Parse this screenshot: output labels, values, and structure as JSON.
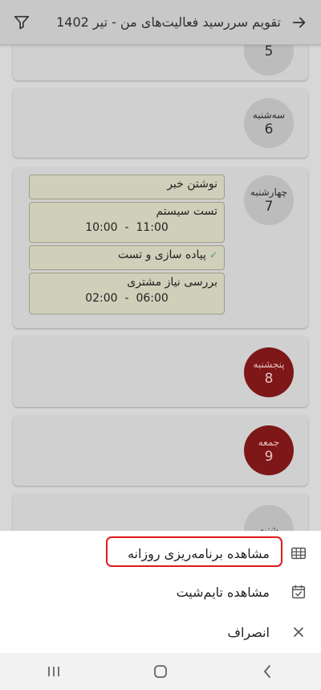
{
  "header": {
    "title": "تقویم سررسید فعالیت‌های من - تیر 1402",
    "back_icon": "arrow-right-icon",
    "filter_icon": "filter-icon"
  },
  "days": [
    {
      "name": "",
      "number": "5"
    },
    {
      "name": "سه‌شنبه",
      "number": "6"
    },
    {
      "name": "چهارشنبه",
      "number": "7"
    },
    {
      "name": "پنجشنبه",
      "number": "8"
    },
    {
      "name": "جمعه",
      "number": "9"
    },
    {
      "name": "شنبه",
      "number": ""
    }
  ],
  "events": [
    {
      "title": "نوشتن خبر",
      "start": "",
      "end": ""
    },
    {
      "title": "تست سیستم",
      "start": "11:00",
      "end": "10:00"
    },
    {
      "title": "پیاده سازی و تست",
      "start": "",
      "end": "",
      "done": true
    },
    {
      "title": "بررسی نیاز مشتری",
      "start": "06:00",
      "end": "02:00"
    }
  ],
  "time_separator": "-",
  "sheet": {
    "items": [
      {
        "label": "مشاهده برنامه‌ریزی روزانه",
        "icon": "table-icon"
      },
      {
        "label": "مشاهده تایم‌شیت",
        "icon": "calendar-check-icon"
      },
      {
        "label": "انصراف",
        "icon": "close-icon"
      }
    ]
  },
  "colors": {
    "highlight": "#e01b1b",
    "friday": "#7e1717",
    "event_bg": "#cfcfba"
  }
}
